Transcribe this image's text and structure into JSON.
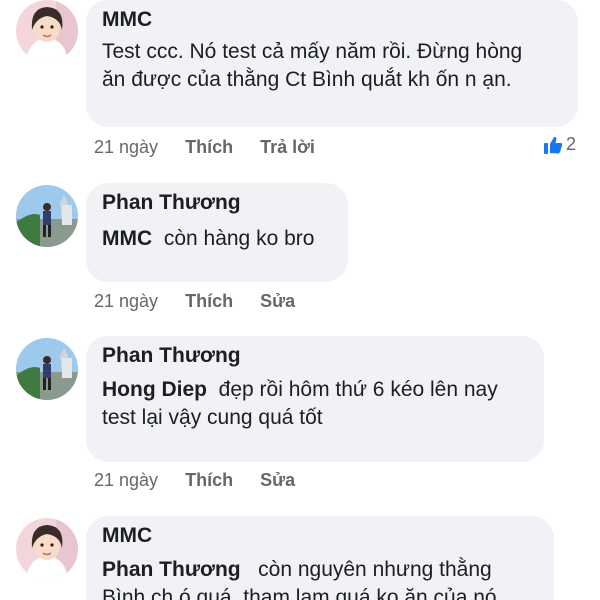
{
  "comments": [
    {
      "author": "MMC",
      "mention": "",
      "text": "Test ccc. Nó test cả mấy năm rồi. Đừng hòng ăn được của thằng Ct Bình quắt kh ốn n ạn.",
      "time": "21 ngày",
      "like_label": "Thích",
      "second_action": "Trả lời",
      "reaction_count": "2"
    },
    {
      "author": "Phan Thương",
      "mention": "MMC",
      "text": "còn hàng ko bro",
      "time": "21 ngày",
      "like_label": "Thích",
      "second_action": "Sửa"
    },
    {
      "author": "Phan Thương",
      "mention": "Hong Diep",
      "text": "đẹp rồi hôm thứ 6 kéo lên nay test lại vậy cung quá tốt",
      "time": "21 ngày",
      "like_label": "Thích",
      "second_action": "Sửa"
    },
    {
      "author": "MMC",
      "mention": "Phan Thương",
      "text": "còn nguyên nhưng thằng Bình ch ó quá, tham lam quá ko ăn của nó",
      "time": "",
      "like_label": "",
      "second_action": ""
    }
  ],
  "colors": {
    "bubble": "#f0f2f5",
    "meta_text": "#65676b",
    "reaction_blue": "#1877f2"
  }
}
